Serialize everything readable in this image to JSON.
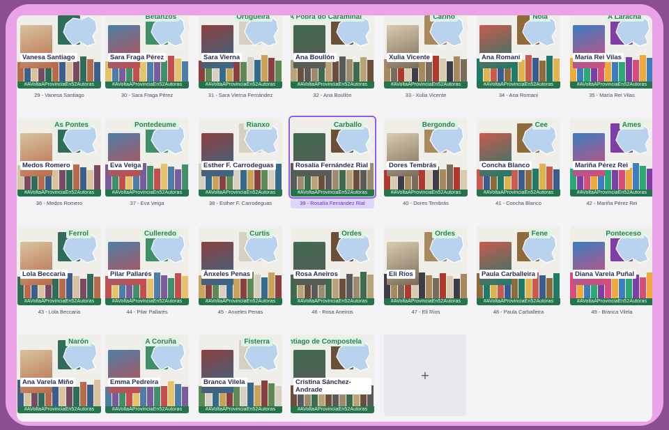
{
  "hashtag": "#AVoltaÁProvinciaEn52Autoras",
  "add_button": {
    "icon": "plus-icon",
    "glyph": "+"
  },
  "colors": {
    "accent_selected": "#8b5cf6",
    "tag_bg": "#23734b",
    "place_bg": "#dff3e6"
  },
  "cards": [
    {
      "caption": "29 - Vanesa Santiago",
      "place": "",
      "author": "Vanesa Santiago",
      "selected": false
    },
    {
      "caption": "30 - Sara Fraga Pérez",
      "place": "Betanzos",
      "author": "Sara Fraga Pérez",
      "selected": false
    },
    {
      "caption": "31 - Sara Vierna Fernández",
      "place": "Ortigueira",
      "author": "Sara Vierna",
      "selected": false
    },
    {
      "caption": "32 - Ana Boullón",
      "place": "A Pobra do Caramiñal",
      "author": "Ana Boullón",
      "selected": false
    },
    {
      "caption": "33 - Xulia Vicente",
      "place": "Cariño",
      "author": "Xulia Vicente",
      "selected": false
    },
    {
      "caption": "34 - Ana Romaní",
      "place": "Noia",
      "author": "Ana Romaní",
      "selected": false
    },
    {
      "caption": "35 - María Rei Vilas",
      "place": "A Laracha",
      "author": "María Rei Vilas",
      "selected": false
    },
    {
      "caption": "36 - Medos Romero",
      "place": "As Pontes",
      "author": "Medos Romero",
      "selected": false
    },
    {
      "caption": "37 - Eva Veiga",
      "place": "Pontedeume",
      "author": "Eva Veiga",
      "selected": false
    },
    {
      "caption": "38 - Esther F. Carrodeguas",
      "place": "Rianxo",
      "author": "Esther F. Carrodeguas",
      "selected": false
    },
    {
      "caption": "39 - Rosalía Fernández Rial",
      "place": "Carballo",
      "author": "Rosalía Fernández Rial",
      "selected": true
    },
    {
      "caption": "40 - Dores Tembrás",
      "place": "Bergondo",
      "author": "Dores Tembrás",
      "selected": false
    },
    {
      "caption": "41 - Concha Blanco",
      "place": "Cee",
      "author": "Concha Blanco",
      "selected": false
    },
    {
      "caption": "42 - Mariña Pérez Rei",
      "place": "Ames",
      "author": "Mariña Pérez Rei",
      "selected": false
    },
    {
      "caption": "43 - Lola Beccaria",
      "place": "Ferrol",
      "author": "Lola Beccaria",
      "selected": false
    },
    {
      "caption": "44 - Pilar Pallarés",
      "place": "Culleredo",
      "author": "Pilar Pallarés",
      "selected": false
    },
    {
      "caption": "45 - Anxeles Penas",
      "place": "Curtis",
      "author": "Ánxeles Penas",
      "selected": false
    },
    {
      "caption": "46 - Rosa Aneiros",
      "place": "Ordes",
      "author": "Rosa Aneiros",
      "selected": false
    },
    {
      "caption": "47 - Eli Ríos",
      "place": "Ordes",
      "author": "Eli Ríos",
      "selected": false
    },
    {
      "caption": "48 - Paula Carballeira",
      "place": "Fene",
      "author": "Paula Carballeira",
      "selected": false
    },
    {
      "caption": "49 - Branca Vilela",
      "place": "Ponteceso",
      "author": "Diana Varela Puñal",
      "selected": false
    },
    {
      "caption": "",
      "place": "Narón",
      "author": "Ana Varela Miño",
      "selected": false
    },
    {
      "caption": "",
      "place": "A Coruña",
      "author": "Emma Pedreira",
      "selected": false
    },
    {
      "caption": "",
      "place": "Fisterra",
      "author": "Branca Vilela",
      "selected": false
    },
    {
      "caption": "",
      "place": "Santiago de Compostela",
      "author": "Cristina Sánchez-Andrade",
      "selected": false
    }
  ]
}
